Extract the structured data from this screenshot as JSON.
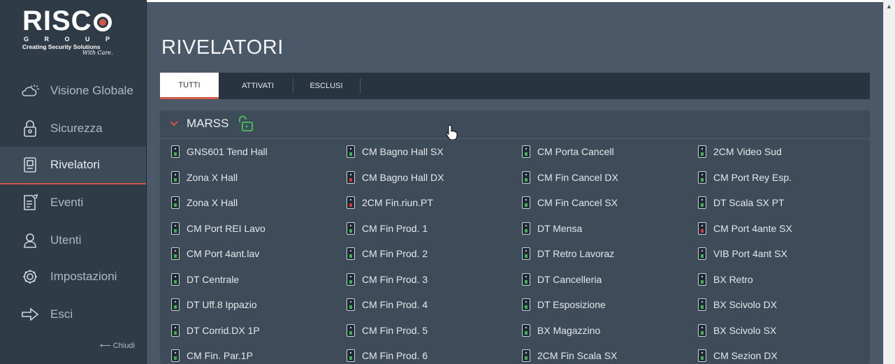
{
  "logo": {
    "main": "RISC",
    "group": "G R O U P",
    "tagline": "Creating Security Solutions",
    "sub": "With Care."
  },
  "nav": [
    {
      "label": "Visione Globale",
      "icon": "cloud-sun-icon"
    },
    {
      "label": "Sicurezza",
      "icon": "lock-icon"
    },
    {
      "label": "Rivelatori",
      "icon": "detector-icon",
      "active": true
    },
    {
      "label": "Eventi",
      "icon": "document-edit-icon"
    },
    {
      "label": "Utenti",
      "icon": "user-icon"
    },
    {
      "label": "Impostazioni",
      "icon": "gear-icon"
    },
    {
      "label": "Esci",
      "icon": "exit-arrow-icon"
    }
  ],
  "close_label": "⟵ Chiudi",
  "page_title": "RIVELATORI",
  "tabs": [
    {
      "label": "TUTTI",
      "active": true
    },
    {
      "label": "ATTIVATI"
    },
    {
      "label": "ESCLUSI"
    }
  ],
  "group": {
    "name": "MARSS",
    "chevron": "⌄",
    "status_icon": "unlocked-icon"
  },
  "colors": {
    "accent": "#d2574b",
    "led_ok": "#3fb34f",
    "led_alarm": "#d9363e",
    "icon_green": "#49c15a"
  },
  "detectors": [
    [
      {
        "name": "GNS601 Tend Hall",
        "status": "ok"
      },
      {
        "name": "Zona X Hall",
        "status": "ok"
      },
      {
        "name": "Zona X Hall",
        "status": "ok"
      },
      {
        "name": "CM Port REI Lavo",
        "status": "ok"
      },
      {
        "name": "CM Port 4ant.lav",
        "status": "ok"
      },
      {
        "name": "DT Centrale",
        "status": "ok"
      },
      {
        "name": "DT Uff.8 Ippazio",
        "status": "ok"
      },
      {
        "name": "DT Corrid.DX 1P",
        "status": "ok"
      }
    ],
    [
      {
        "name": "CM Bagno Hall SX",
        "status": "ok"
      },
      {
        "name": "CM Bagno Hall DX",
        "status": "alarm"
      },
      {
        "name": "2CM Fin.riun.PT",
        "status": "alarm"
      },
      {
        "name": "CM Fin Prod. 1",
        "status": "ok"
      },
      {
        "name": "CM Fin Prod. 2",
        "status": "ok"
      },
      {
        "name": "CM Fin Prod. 3",
        "status": "ok"
      },
      {
        "name": "CM Fin Prod. 4",
        "status": "ok"
      },
      {
        "name": "CM Fin Prod. 5",
        "status": "ok"
      }
    ],
    [
      {
        "name": "CM Porta Cancell",
        "status": "ok"
      },
      {
        "name": "CM Fin Cancel DX",
        "status": "ok"
      },
      {
        "name": "CM Fin Cancel SX",
        "status": "ok"
      },
      {
        "name": "DT Mensa",
        "status": "ok"
      },
      {
        "name": "DT Retro Lavoraz",
        "status": "ok"
      },
      {
        "name": "DT Cancelleria",
        "status": "ok"
      },
      {
        "name": "DT Esposizione",
        "status": "ok"
      },
      {
        "name": "BX Magazzino",
        "status": "ok"
      }
    ],
    [
      {
        "name": "2CM Video Sud",
        "status": "ok"
      },
      {
        "name": "CM Port Rey Esp.",
        "status": "ok"
      },
      {
        "name": "DT Scala SX PT",
        "status": "ok"
      },
      {
        "name": "CM Port 4ante SX",
        "status": "alarm"
      },
      {
        "name": "VIB Port 4ant SX",
        "status": "ok"
      },
      {
        "name": "BX Retro",
        "status": "ok"
      },
      {
        "name": "BX Scivolo DX",
        "status": "ok"
      },
      {
        "name": "BX Scivolo SX",
        "status": "ok"
      }
    ]
  ],
  "partial_row": [
    {
      "name": "CM Fin. Par.1P",
      "status": "ok"
    },
    {
      "name": "CM Fin Prod. 6",
      "status": "ok"
    },
    {
      "name": "2CM Fin Scala SX",
      "status": "ok"
    },
    {
      "name": "CM Sezion DX",
      "status": "ok"
    }
  ]
}
